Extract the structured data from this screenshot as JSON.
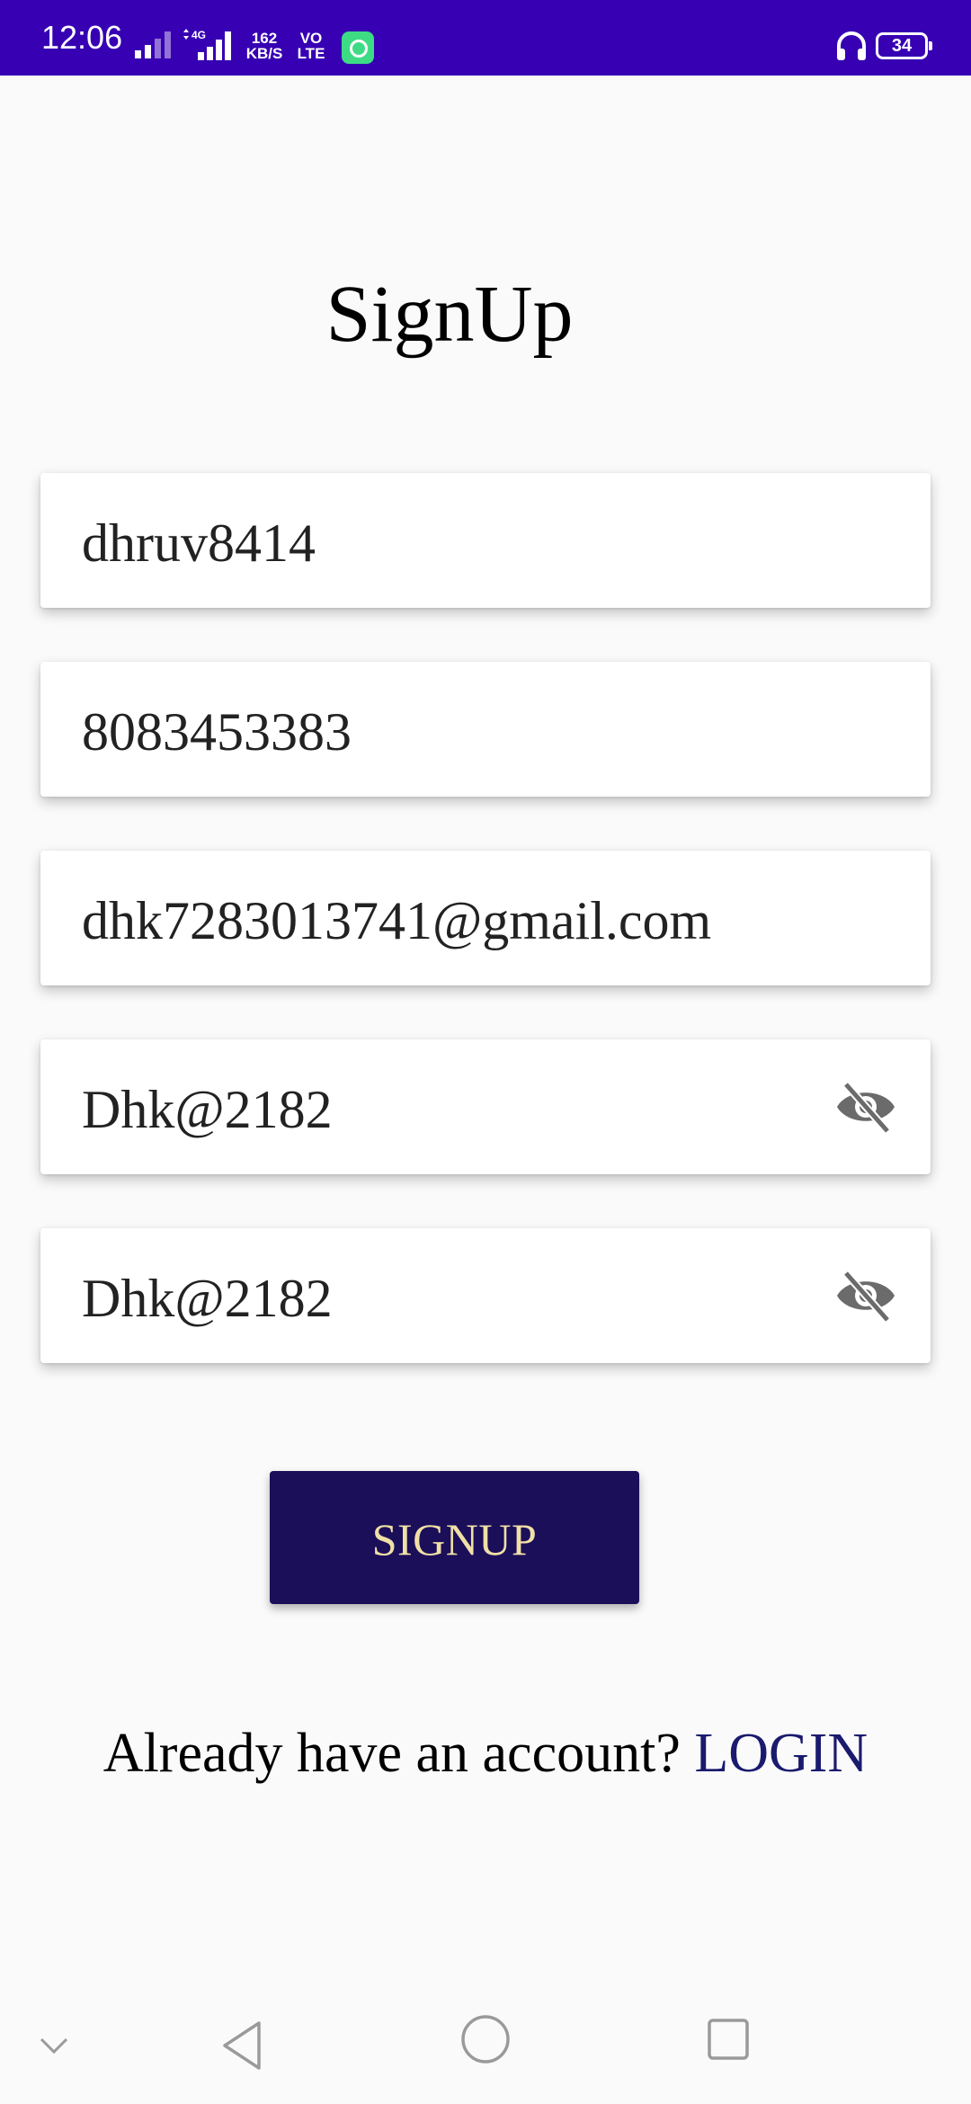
{
  "status_bar": {
    "time": "12:06",
    "network_type": "4G",
    "speed_value": "162",
    "speed_unit": "KB/S",
    "volte_line1": "VO",
    "volte_line2": "LTE",
    "battery": "34"
  },
  "title": "SignUp",
  "fields": {
    "username": "dhruv8414",
    "phone": "8083453383",
    "email": "dhk7283013741@gmail.com",
    "password": "Dhk@2182",
    "confirm_password": "Dhk@2182"
  },
  "signup_button": "SIGNUP",
  "login_prompt": {
    "text": "Already have an account?",
    "link": "LOGIN"
  },
  "colors": {
    "status_bar": "#3700b3",
    "button_bg": "#1b0f5a",
    "button_text": "#f1e0a6",
    "link": "#1a1a6e"
  },
  "icons": {
    "password_toggle": "eye-off-icon",
    "confirm_password_toggle": "eye-off-icon",
    "nav_collapse": "chevron-down-icon",
    "nav_back": "triangle-back-icon",
    "nav_home": "circle-home-icon",
    "nav_recents": "square-recents-icon"
  }
}
